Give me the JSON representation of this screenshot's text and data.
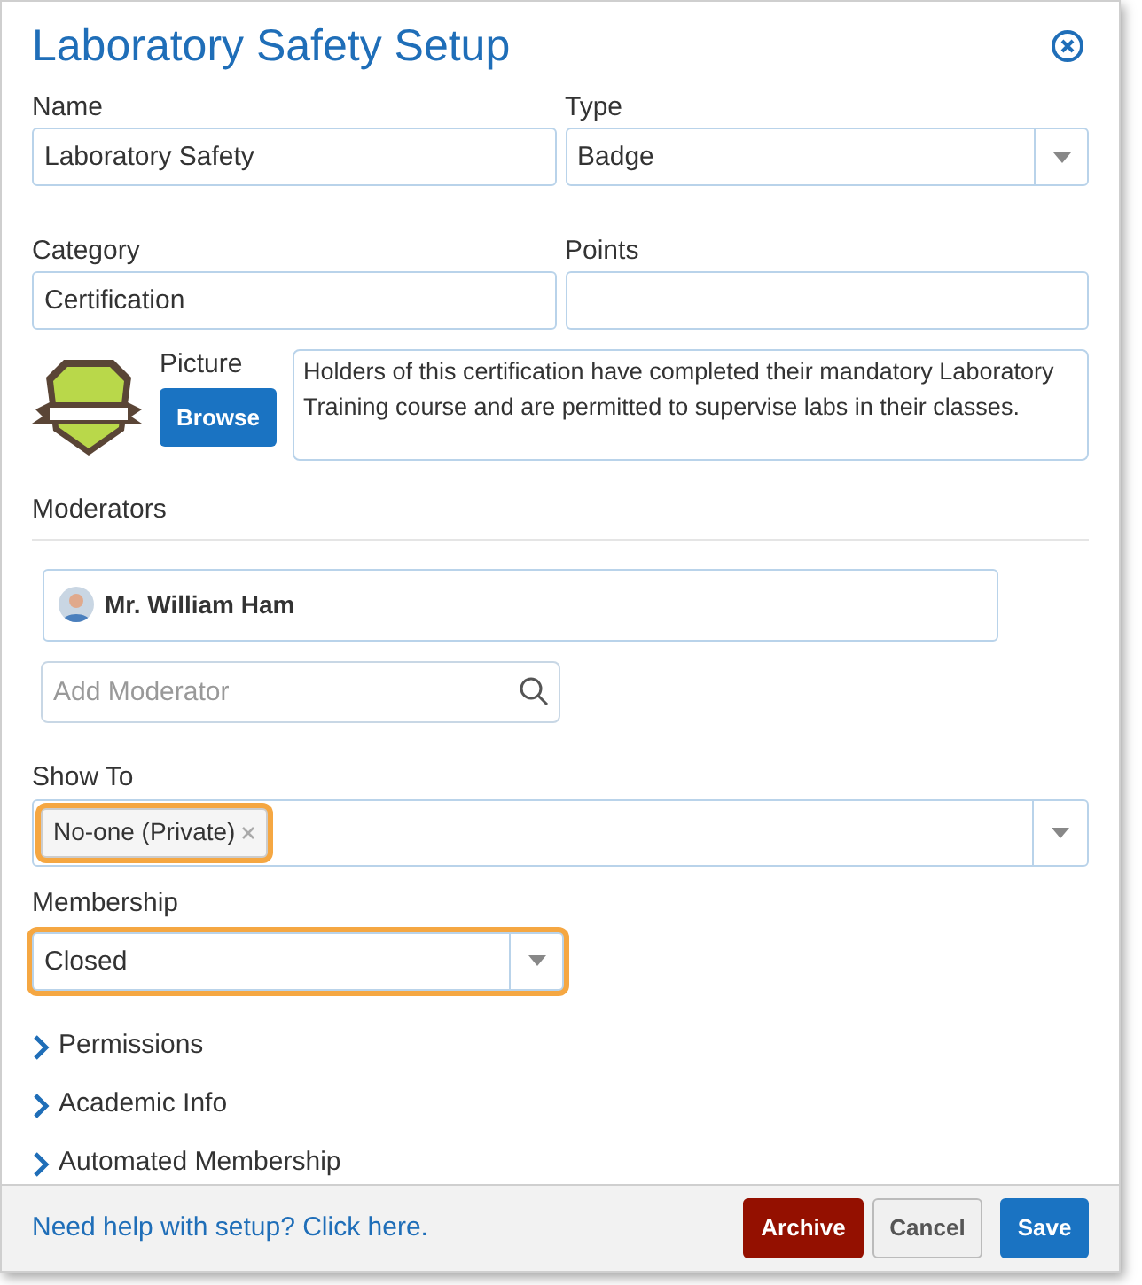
{
  "dialog": {
    "title": "Laboratory Safety Setup"
  },
  "fields": {
    "name": {
      "label": "Name",
      "value": "Laboratory Safety"
    },
    "type": {
      "label": "Type",
      "value": "Badge"
    },
    "category": {
      "label": "Category",
      "value": "Certification"
    },
    "points": {
      "label": "Points"
    }
  },
  "picture": {
    "label": "Picture",
    "button": "Browse",
    "description": "Holders of this certification have completed their mandatory Laboratory Training course and are permitted to supervise labs in their classes."
  },
  "moderators": {
    "label": "Moderators",
    "people": [
      {
        "name": "Mr. William Ham"
      }
    ],
    "search_placeholder": "Add Moderator"
  },
  "show_to": {
    "label": "Show To",
    "tags": [
      "No-one (Private)"
    ],
    "highlighted": true
  },
  "membership": {
    "label": "Membership",
    "value": "Closed",
    "highlighted": true
  },
  "sections": [
    {
      "label": "Permissions",
      "expanded": false
    },
    {
      "label": "Academic Info",
      "expanded": false
    },
    {
      "label": "Automated Membership",
      "expanded": false
    }
  ],
  "footer": {
    "help_link": "Need help with setup? Click here.",
    "buttons": [
      {
        "label": "Archive",
        "kind": "danger"
      },
      {
        "label": "Cancel",
        "kind": "default"
      },
      {
        "label": "Save",
        "kind": "primary"
      }
    ]
  }
}
